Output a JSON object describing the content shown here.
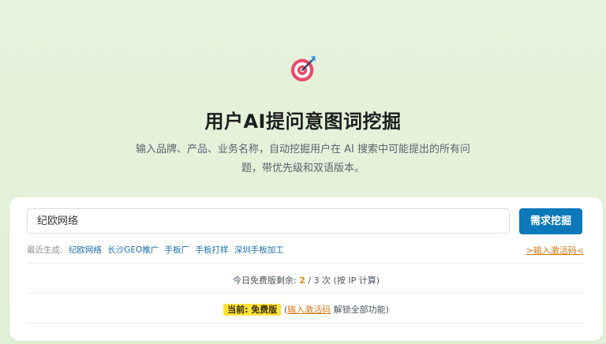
{
  "colors": {
    "background": "#e3f1d9",
    "primary_button": "#0b78b9",
    "accent_orange": "#d6781a",
    "badge_yellow": "#ffe23d"
  },
  "hero": {
    "icon": "target-arrow-icon",
    "title": "用户AI提问意图词挖掘",
    "subtitle": "输入品牌、产品、业务名称，自动挖掘用户在 AI 搜索中可能提出的所有问题，带优先级和双语版本。"
  },
  "search": {
    "value": "纪欧网络",
    "button_label": "需求挖掘"
  },
  "recent": {
    "label": "最近生成:",
    "items": [
      "纪欧网络",
      "长沙GEO推广",
      "手板厂",
      "手板打样",
      "深圳手板加工"
    ]
  },
  "activate_link": ">输入激活码<",
  "quota": {
    "prefix": "今日免费版剩余:",
    "remaining": "2",
    "total_text": "/ 3 次 (按 IP 计算)"
  },
  "plan": {
    "badge": "当前: 免费版",
    "open_paren": "(",
    "link": "输入激活码",
    "suffix": "解锁全部功能)"
  }
}
